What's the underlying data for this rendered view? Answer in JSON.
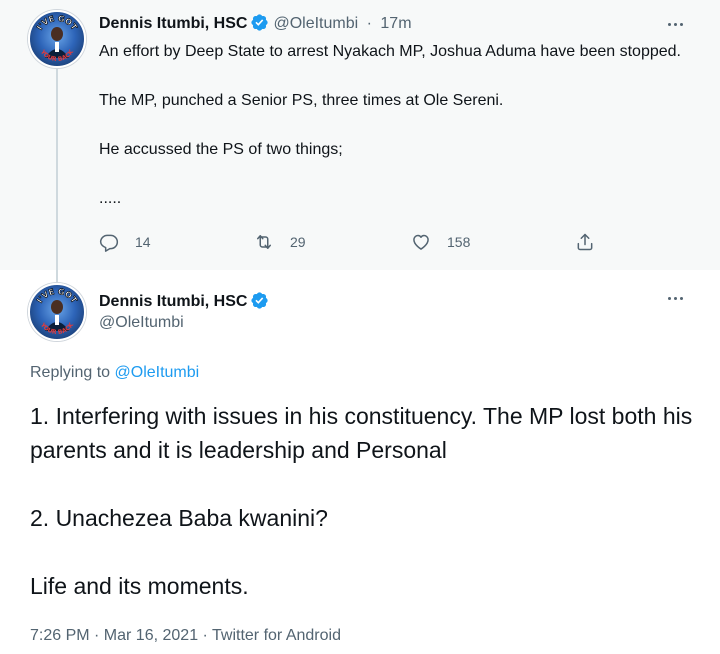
{
  "tweet1": {
    "author_name": "Dennis Itumbi, HSC",
    "handle": "@OleItumbi",
    "separator": "·",
    "time_ago": "17m",
    "paragraphs": [
      "An effort by Deep State to arrest Nyakach MP,  Joshua Aduma have been stopped.",
      "The MP,  punched a Senior PS, three times at Ole Sereni.",
      "He accussed the PS of two things;",
      "....."
    ],
    "reply_count": "14",
    "retweet_count": "29",
    "like_count": "158"
  },
  "tweet2": {
    "author_name": "Dennis Itumbi, HSC",
    "handle": "@OleItumbi",
    "replying_prefix": "Replying to",
    "replying_to": "@OleItumbi",
    "paragraphs": [
      "1. Interfering with issues in his constituency. The MP lost both his parents and it is leadership and Personal",
      "2. Unachezea Baba kwanini?",
      "Life and its moments."
    ],
    "meta": "7:26 PM · Mar 16, 2021 · Twitter for Android"
  },
  "avatar_text": "I'VE GOT YOUR BACK",
  "colors": {
    "accent": "#1d9bf0",
    "secondary_text": "#536471",
    "primary_text": "#0f1419",
    "tweet1_bg": "#f7f9f9"
  },
  "icons": [
    "verified-badge-icon",
    "more-options-icon",
    "reply-icon",
    "retweet-icon",
    "like-icon",
    "share-icon"
  ]
}
